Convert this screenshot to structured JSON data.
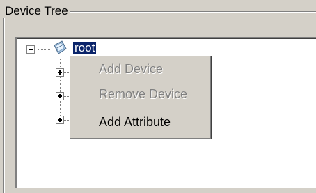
{
  "group": {
    "title": "Device Tree"
  },
  "tree": {
    "root": {
      "label": "root",
      "icon": "device-icon",
      "expanded": true
    },
    "children": [
      {
        "expander": "plus"
      },
      {
        "expander": "plus"
      },
      {
        "expander": "plus"
      }
    ]
  },
  "context_menu": {
    "items": [
      {
        "label": "Add Device",
        "enabled": false
      },
      {
        "label": "Remove Device",
        "enabled": false
      },
      {
        "label": "Add Attribute",
        "enabled": true
      }
    ]
  },
  "colors": {
    "window_bg": "#d4d0c8",
    "selection_bg": "#0a246a",
    "disabled_text": "#808080"
  }
}
